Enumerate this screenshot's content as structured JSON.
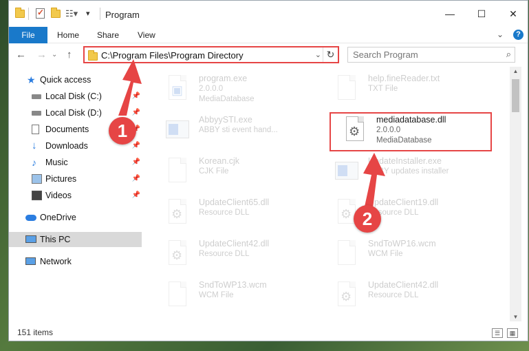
{
  "window": {
    "title": "Program",
    "controls": {
      "minimize": "—",
      "maximize": "☐",
      "close": "✕"
    }
  },
  "ribbon": {
    "tabs": [
      "File",
      "Home",
      "Share",
      "View"
    ],
    "expand": "⌄",
    "help": "?"
  },
  "nav": {
    "back": "←",
    "forward": "→",
    "up": "↑",
    "address": "C:\\Program Files\\Program Directory",
    "address_dropdown": "⌄",
    "refresh": "↻",
    "search_placeholder": "Search Program",
    "search_icon": "search-icon"
  },
  "sidebar": {
    "items": [
      {
        "label": "Quick access",
        "icon": "star-icon",
        "pinned": false
      },
      {
        "label": "Local Disk (C:)",
        "icon": "drive-icon",
        "pinned": true
      },
      {
        "label": "Local Disk (D:)",
        "icon": "drive-icon",
        "pinned": true
      },
      {
        "label": "Documents",
        "icon": "documents-icon",
        "pinned": true
      },
      {
        "label": "Downloads",
        "icon": "download-icon",
        "pinned": true
      },
      {
        "label": "Music",
        "icon": "music-icon",
        "pinned": true
      },
      {
        "label": "Pictures",
        "icon": "pictures-icon",
        "pinned": true
      },
      {
        "label": "Videos",
        "icon": "videos-icon",
        "pinned": true
      },
      {
        "label": "OneDrive",
        "icon": "cloud-icon",
        "pinned": false
      },
      {
        "label": "This PC",
        "icon": "computer-icon",
        "pinned": false,
        "selected": true
      },
      {
        "label": "Network",
        "icon": "network-icon",
        "pinned": false
      }
    ]
  },
  "files": [
    {
      "name": "program.exe",
      "line2": "2.0.0.0",
      "line3": "MediaDatabase",
      "type": "exe"
    },
    {
      "name": "help.fineReader.txt",
      "line2": "TXT File",
      "line3": "",
      "type": "doc"
    },
    {
      "name": "AbbyySTI.exe",
      "line2": "ABBY sti event hand...",
      "line3": "",
      "type": "exe"
    },
    {
      "name": "mediadatabase.dll",
      "line2": "2.0.0.0",
      "line3": "MediaDatabase",
      "type": "dll",
      "highlighted": true
    },
    {
      "name": "Korean.cjk",
      "line2": "CJK File",
      "line3": "",
      "type": "doc"
    },
    {
      "name": "UpdateInstaller.exe",
      "line2": "ABBY updates installer",
      "line3": "",
      "type": "exe"
    },
    {
      "name": "UpdateClient65.dll",
      "line2": "Resource DLL",
      "line3": "",
      "type": "dll"
    },
    {
      "name": "UpdateClient19.dll",
      "line2": "Resource DLL",
      "line3": "",
      "type": "dll"
    },
    {
      "name": "UpdateClient42.dll",
      "line2": "Resource DLL",
      "line3": "",
      "type": "dll"
    },
    {
      "name": "SndToWP16.wcm",
      "line2": "WCM File",
      "line3": "",
      "type": "doc"
    },
    {
      "name": "SndToWP13.wcm",
      "line2": "WCM File",
      "line3": "",
      "type": "doc"
    },
    {
      "name": "UpdateClient42.dll",
      "line2": "Resource DLL",
      "line3": "",
      "type": "dll"
    }
  ],
  "status": {
    "item_count": "151 items"
  },
  "annotations": {
    "step1": "1",
    "step2": "2",
    "color": "#e64545"
  }
}
